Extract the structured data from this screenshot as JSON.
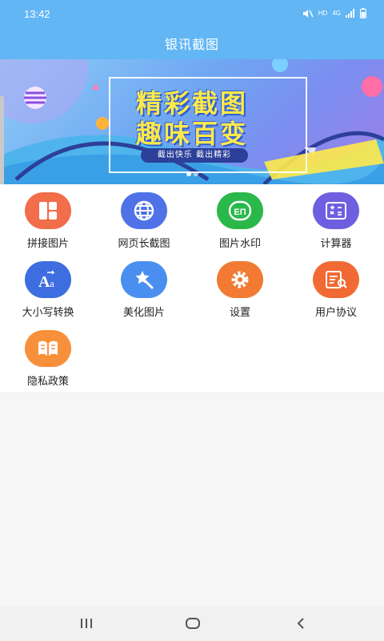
{
  "status_bar": {
    "time": "13:42",
    "hd_label": "HD",
    "network_label": "4G",
    "icons": [
      "mute-icon",
      "signal-icon",
      "battery-icon"
    ]
  },
  "app": {
    "title": "银讯截图"
  },
  "banner": {
    "headline_1": "精彩截图",
    "headline_2": "趣味百变",
    "tagline": "截出快乐 截出精彩",
    "page_count": 2,
    "active_page": 1
  },
  "features": [
    {
      "label": "拼接图片",
      "icon": "collage-icon",
      "color": "#f26d4a"
    },
    {
      "label": "网页长截图",
      "icon": "globe-icon",
      "color": "#4f72e8"
    },
    {
      "label": "图片水印",
      "icon": "watermark-icon",
      "color": "#2bb84a"
    },
    {
      "label": "计算器",
      "icon": "calculator-icon",
      "color": "#6e5fe0"
    },
    {
      "label": "大小写转换",
      "icon": "text-case-icon",
      "color": "#3e6de0"
    },
    {
      "label": "美化图片",
      "icon": "magic-wand-icon",
      "color": "#4a8ff0"
    },
    {
      "label": "设置",
      "icon": "gear-icon",
      "color": "#f27a33"
    },
    {
      "label": "用户协议",
      "icon": "agreement-icon",
      "color": "#f26a33"
    },
    {
      "label": "隐私政策",
      "icon": "book-icon",
      "color": "#f7903a"
    }
  ],
  "nav": {
    "icons": [
      "recent-apps-icon",
      "home-icon",
      "back-icon"
    ]
  },
  "colors": {
    "header": "#62b6f4",
    "panel": "#ffffff",
    "background": "#f6f6f6"
  }
}
